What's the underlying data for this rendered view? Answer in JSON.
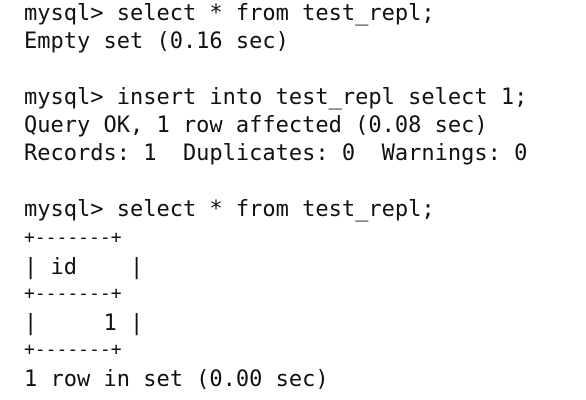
{
  "terminal": {
    "lines": [
      "mysql> select * from test_repl;",
      "Empty set (0.16 sec)",
      "",
      "mysql> insert into test_repl select 1;",
      "Query OK, 1 row affected (0.08 sec)",
      "Records: 1  Duplicates: 0  Warnings: 0",
      "",
      "mysql> select * from test_repl;",
      "+-------+",
      "| id    |",
      "+-------+",
      "|     1 |",
      "+-------+",
      "1 row in set (0.00 sec)"
    ]
  }
}
